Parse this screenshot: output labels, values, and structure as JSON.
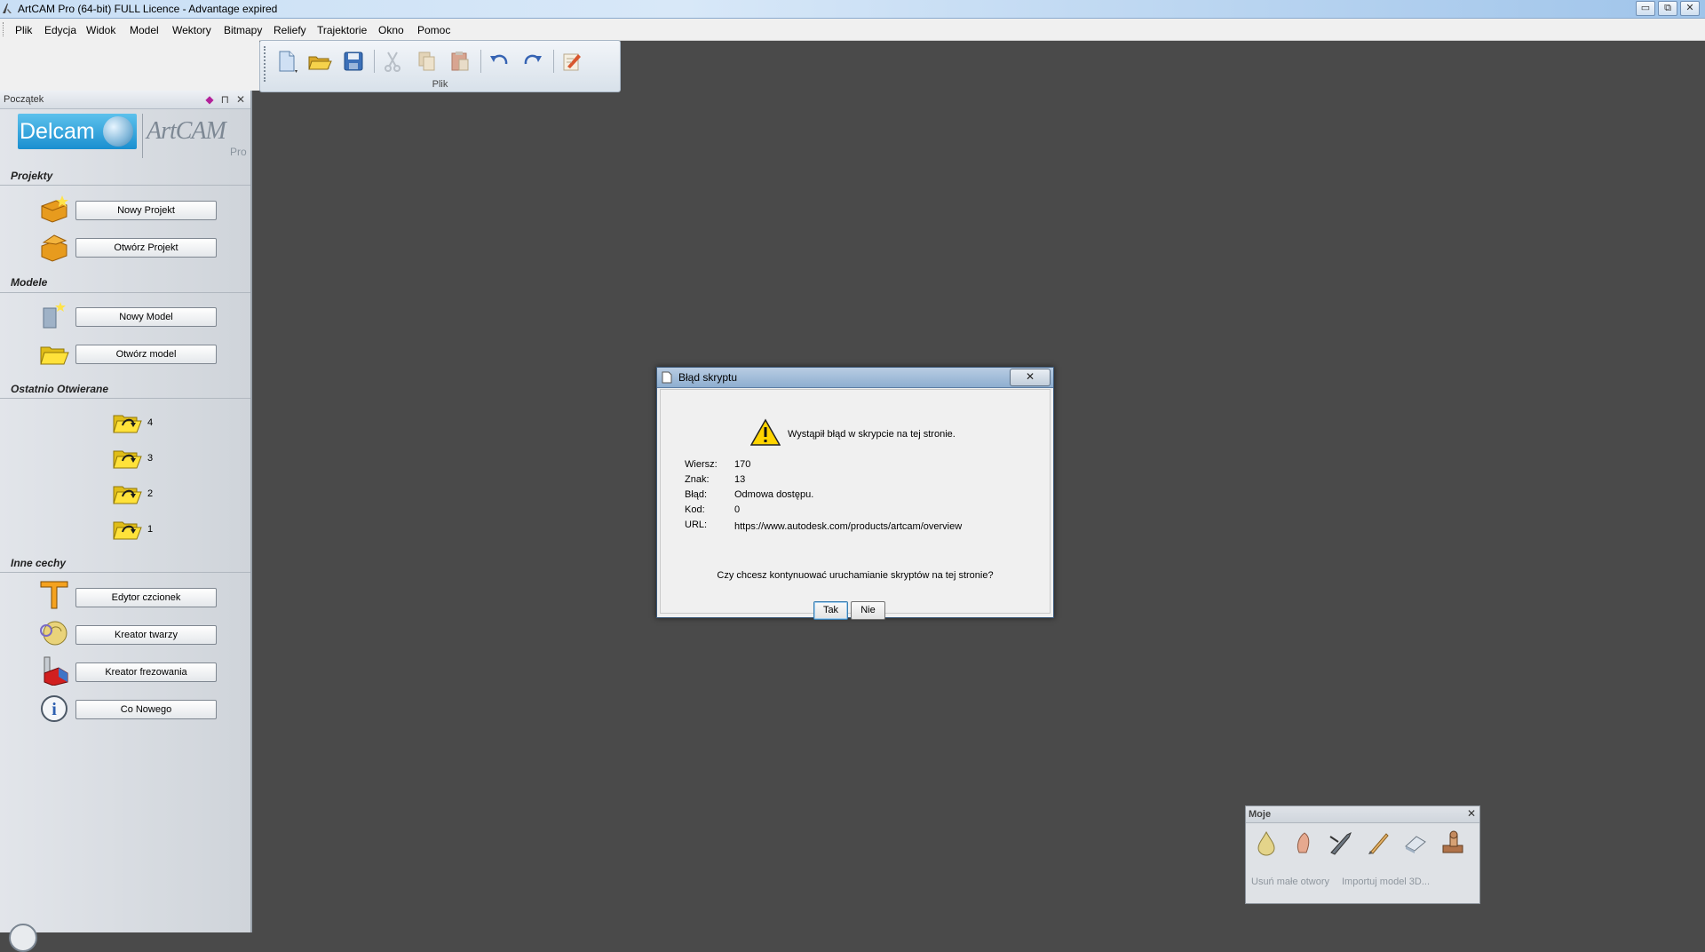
{
  "window": {
    "title": "ArtCAM Pro (64-bit) FULL Licence - Advantage expired",
    "minimize": "▭",
    "restore": "⧉",
    "close": "✕"
  },
  "menu": [
    "Plik",
    "Edycja",
    "Widok",
    "Model",
    "Wektory",
    "Bitmapy",
    "Reliefy",
    "Trajektorie",
    "Okno",
    "Pomoc"
  ],
  "toolbar": {
    "label": "Plik",
    "buttons": [
      "new-file-icon",
      "open-folder-icon",
      "save-icon",
      "cut-icon",
      "copy-icon",
      "paste-icon",
      "undo-icon",
      "redo-icon",
      "notes-icon"
    ]
  },
  "panel": {
    "title": "Początek",
    "logo_left": "Delcam",
    "logo_right_main": "ArtCAM",
    "logo_right_sub": "Pro",
    "sections": {
      "projects": "Projekty",
      "models": "Modele",
      "recent": "Ostatnio Otwierane",
      "other": "Inne cechy"
    },
    "buttons": {
      "new_project": "Nowy Projekt",
      "open_project": "Otwórz Projekt",
      "new_model": "Nowy Model",
      "open_model": "Otwórz model",
      "font_editor": "Edytor czcionek",
      "face_wizard": "Kreator twarzy",
      "milling_wizard": "Kreator frezowania",
      "whats_new": "Co Nowego"
    },
    "recent_items": [
      "4",
      "3",
      "2",
      "1"
    ]
  },
  "dialog": {
    "title": "Błąd skryptu",
    "close": "✕",
    "message": "Wystąpił błąd w skrypcie na tej stronie.",
    "fields": [
      {
        "label": "Wiersz:",
        "value": "170"
      },
      {
        "label": "Znak:",
        "value": "13"
      },
      {
        "label": "Błąd:",
        "value": "Odmowa dostępu."
      },
      {
        "label": "Kod:",
        "value": "0"
      },
      {
        "label": "URL:",
        "value": "https://www.autodesk.com/products/artcam/overview"
      }
    ],
    "question": "Czy chcesz kontynuować uruchamianie skryptów na tej stronie?",
    "yes": "Tak",
    "no": "Nie"
  },
  "moje": {
    "title": "Moje",
    "close": "✕",
    "action1": "Usuń małe otwory",
    "action2": "Importuj model 3D..."
  }
}
